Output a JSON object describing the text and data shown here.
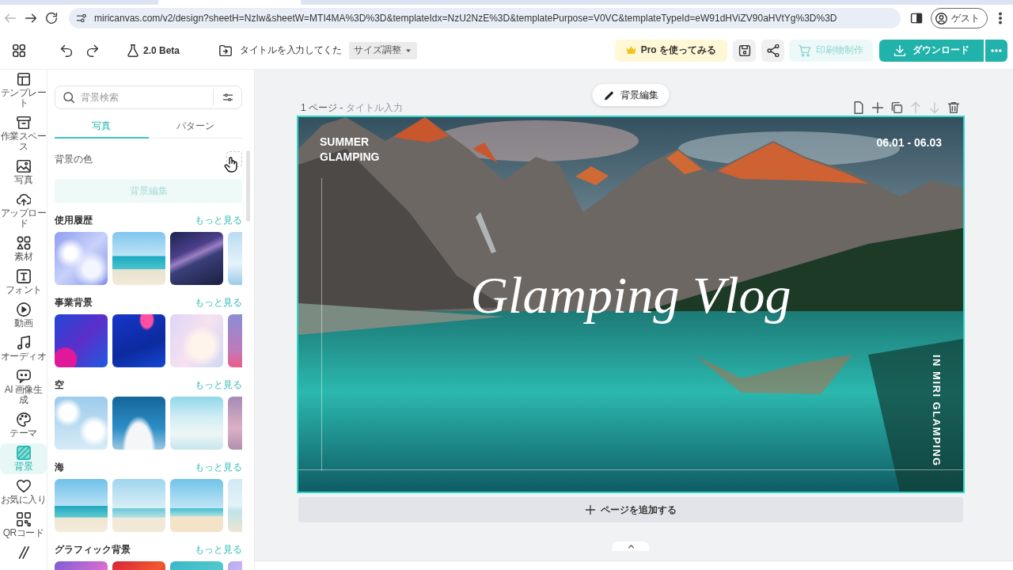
{
  "browser": {
    "nav_buttons": [
      {
        "kind": "back",
        "disabled": true
      },
      {
        "kind": "forward",
        "disabled": false
      },
      {
        "kind": "reload",
        "disabled": false
      }
    ],
    "url": "miricanvas.com/v2/design?sheetH=NzIw&sheetW=MTI4MA%3D%3D&templateIdx=NzU2NzE%3D&templatePurpose=V0VC&templateTypeId=eW91dHViZV90aHVtYg%3D%3D",
    "profile": "ゲスト"
  },
  "header": {
    "version": "2.0 Beta",
    "title": "タイトルを入力してくた",
    "size_button": "サイズ調整",
    "pro_button": "Pro を使ってみる",
    "print_button": {
      "label": "印刷物制作",
      "disabled": true
    },
    "download_button": "ダウンロード"
  },
  "rail": {
    "items": [
      {
        "kind": "template",
        "label": "テンプレート",
        "selected": false
      },
      {
        "kind": "workspace",
        "label": "作業スペース",
        "selected": false
      },
      {
        "kind": "photo",
        "label": "写真",
        "selected": false
      },
      {
        "kind": "upload",
        "label": "アップロード",
        "selected": false
      },
      {
        "kind": "elements",
        "label": "素材",
        "selected": false
      },
      {
        "kind": "font",
        "label": "フォント",
        "selected": false
      },
      {
        "kind": "video",
        "label": "動画",
        "selected": false
      },
      {
        "kind": "audio",
        "label": "オーディオ",
        "selected": false
      },
      {
        "kind": "ai",
        "label": "AI 画像生成",
        "selected": false
      },
      {
        "kind": "theme",
        "label": "テーマ",
        "selected": false
      },
      {
        "kind": "background",
        "label": "背景",
        "selected": true
      },
      {
        "kind": "favorite",
        "label": "お気に入り",
        "selected": false
      },
      {
        "kind": "qr",
        "label": "QRコード",
        "selected": false
      },
      {
        "kind": "more",
        "selected": false
      }
    ]
  },
  "panel": {
    "search": {
      "placeholder": "背景検索"
    },
    "tabs": [
      {
        "label": "写真",
        "selected": true
      },
      {
        "label": "パターン",
        "selected": false
      }
    ],
    "color_label": "背景の色",
    "edit_button": {
      "label": "背景編集",
      "disabled": true
    },
    "sections": [
      {
        "title": "使用履歴",
        "more": "もっと見る",
        "thumbnails": [
          {
            "kind": "clouds"
          },
          {
            "kind": "beach"
          },
          {
            "kind": "night-sky"
          },
          {
            "kind": "pale-sky"
          }
        ]
      },
      {
        "title": "事業背景",
        "more": "もっと見る",
        "thumbnails": [
          {
            "kind": "blue-wave"
          },
          {
            "kind": "deep-blue"
          },
          {
            "kind": "pastel"
          },
          {
            "kind": "violet"
          }
        ]
      },
      {
        "title": "空",
        "more": "もっと見る",
        "thumbnails": [
          {
            "kind": "cloud-sky"
          },
          {
            "kind": "blue-sky"
          },
          {
            "kind": "mist"
          },
          {
            "kind": "dusk"
          }
        ]
      },
      {
        "title": "海",
        "more": "もっと見る",
        "thumbnails": [
          {
            "kind": "palm"
          },
          {
            "kind": "sail"
          },
          {
            "kind": "gulls"
          },
          {
            "kind": "shore"
          }
        ]
      },
      {
        "title": "グラフィック背景",
        "more": "もっと見る",
        "thumbnails": [
          {
            "kind": "magenta"
          },
          {
            "kind": "red"
          },
          {
            "kind": "teal"
          },
          {
            "kind": "lilac"
          }
        ]
      }
    ]
  },
  "workspace": {
    "edit_background_button": "背景編集",
    "page_label": "1 ページ -",
    "page_title": {
      "placeholder": "タイトル入力"
    },
    "page_tools": [
      {
        "kind": "page",
        "disabled": false
      },
      {
        "kind": "add",
        "disabled": false
      },
      {
        "kind": "duplicate",
        "disabled": false
      },
      {
        "kind": "move_up",
        "disabled": true
      },
      {
        "kind": "move_down",
        "disabled": true
      },
      {
        "kind": "delete",
        "disabled": false
      }
    ],
    "design": {
      "selected": true,
      "top_left": "SUMMER\nGLAMPING",
      "date": "06.01 - 06.03",
      "headline": "Glamping Vlog",
      "side_text": "IN MIRI GLAMPING"
    },
    "add_page_button": "ページを追加する"
  }
}
